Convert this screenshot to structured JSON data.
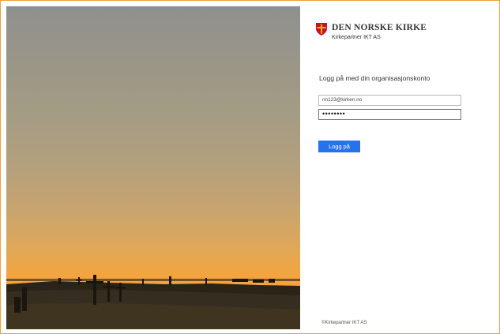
{
  "brand": {
    "name": "DEN NORSKE KIRKE",
    "subtitle": "Kirkepartner IKT AS"
  },
  "login": {
    "heading": "Logg på med din organisasjonskonto",
    "email_value": "nn123@kirken.no",
    "password_mask": "••••••••",
    "submit_label": "Logg på"
  },
  "footer": {
    "copyright": "©Kirkepartner IKT AS"
  },
  "colors": {
    "frame_border": "#f0a230",
    "button": "#2672ec",
    "shield_red": "#c8102e",
    "shield_gold": "#f2b600"
  },
  "icons": [
    "church-shield-logo-icon",
    "sunset-cemetery-photo"
  ]
}
